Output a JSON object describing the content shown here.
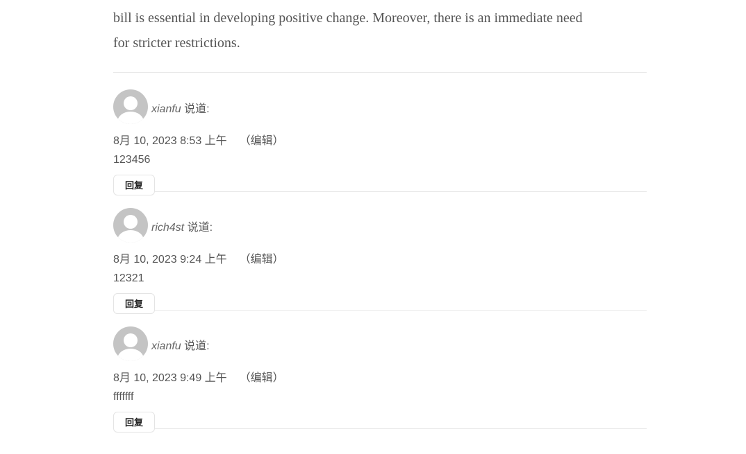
{
  "article": {
    "line1": "bill is essential in developing positive change. Moreover, there is an immediate need",
    "line2": "for stricter restrictions."
  },
  "comments": [
    {
      "author": "xianfu",
      "says": "说道:",
      "date": "8月 10, 2023 8:53 上午",
      "edit": "（编辑）",
      "body": "123456",
      "reply": "回复"
    },
    {
      "author": "rich4st",
      "says": "说道:",
      "date": "8月 10, 2023 9:24 上午",
      "edit": "（编辑）",
      "body": "12321",
      "reply": "回复"
    },
    {
      "author": "xianfu",
      "says": "说道:",
      "date": "8月 10, 2023 9:49 上午",
      "edit": "（编辑）",
      "body": "fffffff",
      "reply": "回复"
    }
  ]
}
